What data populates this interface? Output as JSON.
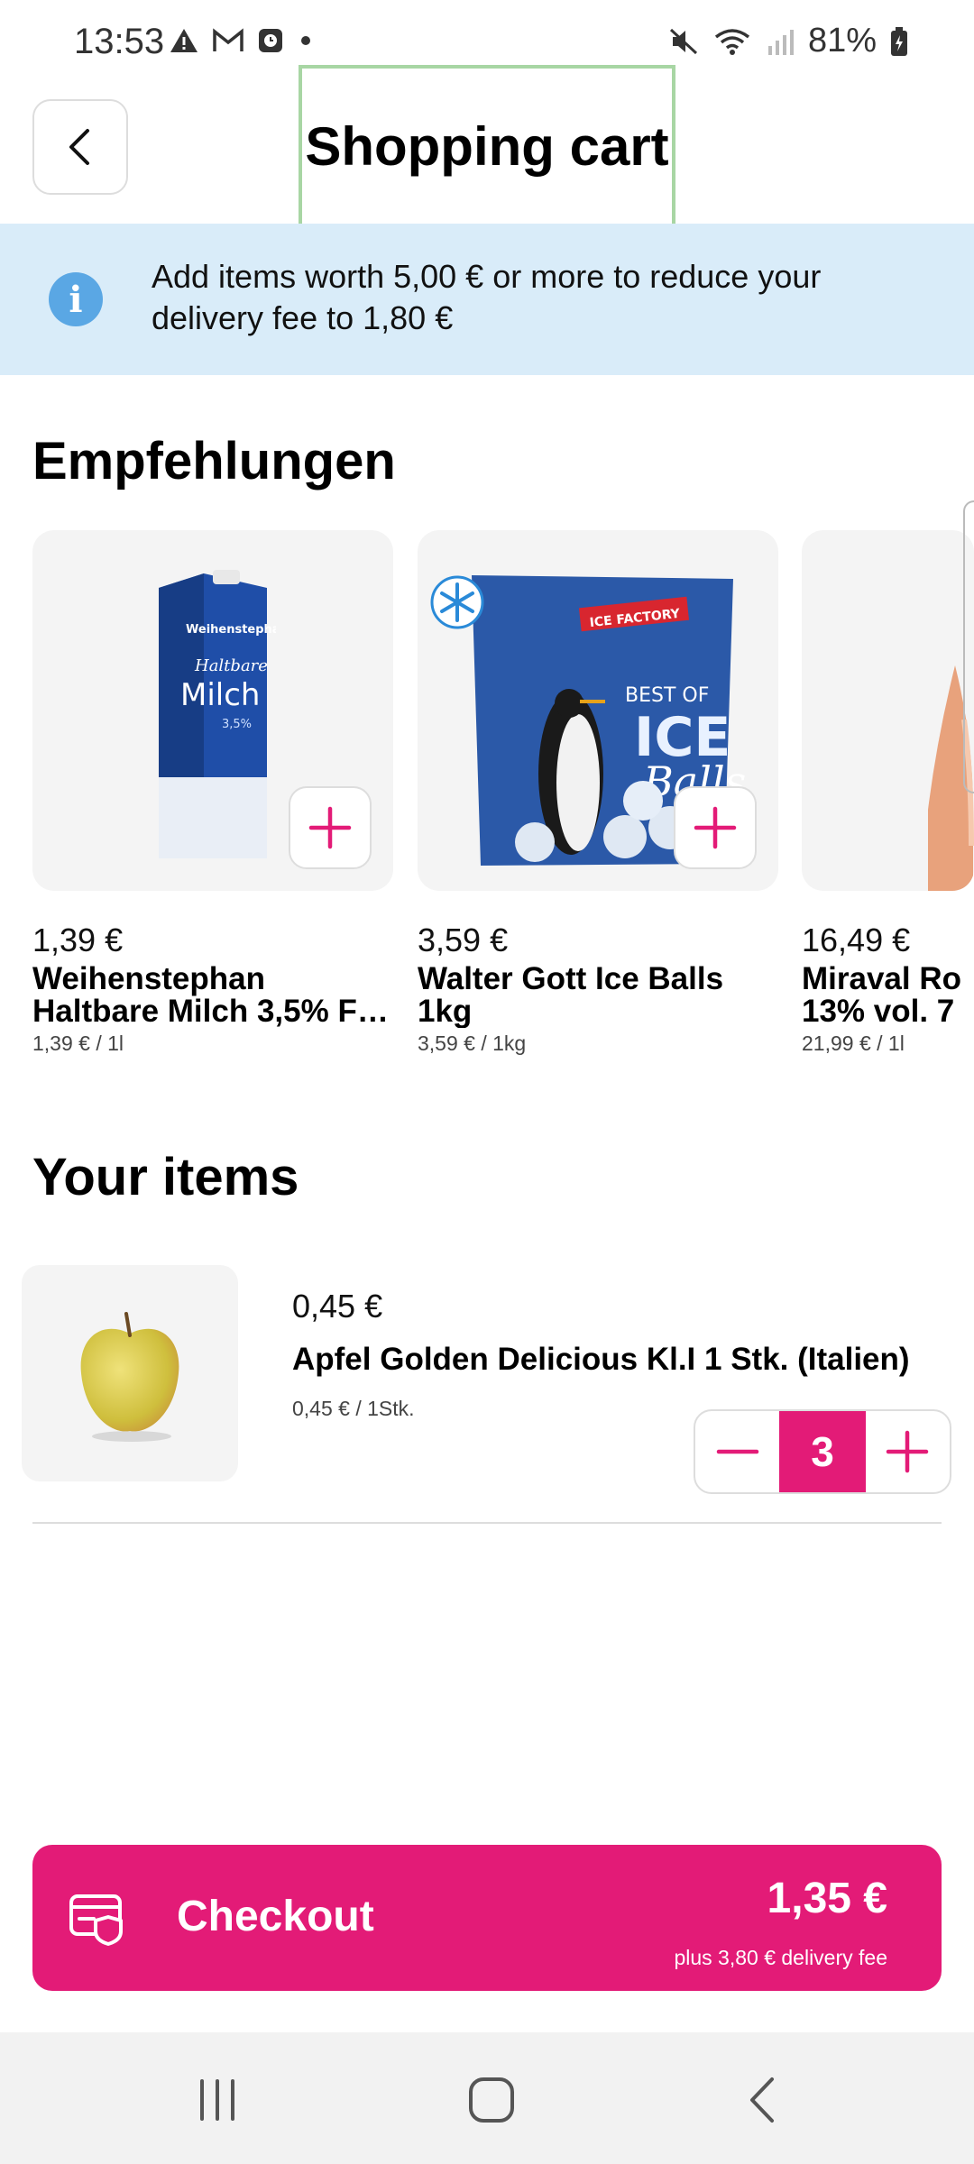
{
  "status_bar": {
    "time": "13:53",
    "battery": "81%",
    "icons_left": [
      "warning-icon",
      "gmail-icon",
      "clock-app-icon",
      "dot-icon"
    ],
    "icons_right": [
      "mute-icon",
      "wifi-icon",
      "signal-icon",
      "battery-charging-icon"
    ]
  },
  "header": {
    "title": "Shopping cart"
  },
  "banner": {
    "text": "Add items worth 5,00 € or more to reduce your delivery fee to 1,80 €"
  },
  "recommendations": {
    "heading": "Empfehlungen",
    "items": [
      {
        "price": "1,39 €",
        "name": "Weihenstephan Haltbare Milch 3,5% F…",
        "unit_price": "1,39 € / 1l",
        "image": "milk-carton"
      },
      {
        "price": "3,59 €",
        "name": "Walter Gott Ice Balls 1kg",
        "unit_price": "3,59 € / 1kg",
        "image": "ice-balls-bag"
      },
      {
        "price": "16,49 €",
        "name": "Miraval Ro… 13% vol. 7…",
        "unit_price": "21,99 € / 1l",
        "image": "rose-wine-bottle"
      }
    ]
  },
  "cart": {
    "heading": "Your items",
    "items": [
      {
        "price": "0,45 €",
        "name": "Apfel Golden Delicious Kl.I 1 Stk. (Italien)",
        "unit_price": "0,45 € / 1Stk.",
        "quantity": "3",
        "image": "apple"
      }
    ]
  },
  "checkout": {
    "label": "Checkout",
    "total": "1,35 €",
    "delivery_note": "plus 3,80 € delivery fee"
  },
  "colors": {
    "accent": "#e31b77",
    "banner_bg": "#d9ecf9",
    "info_blue": "#5aa7e4"
  }
}
